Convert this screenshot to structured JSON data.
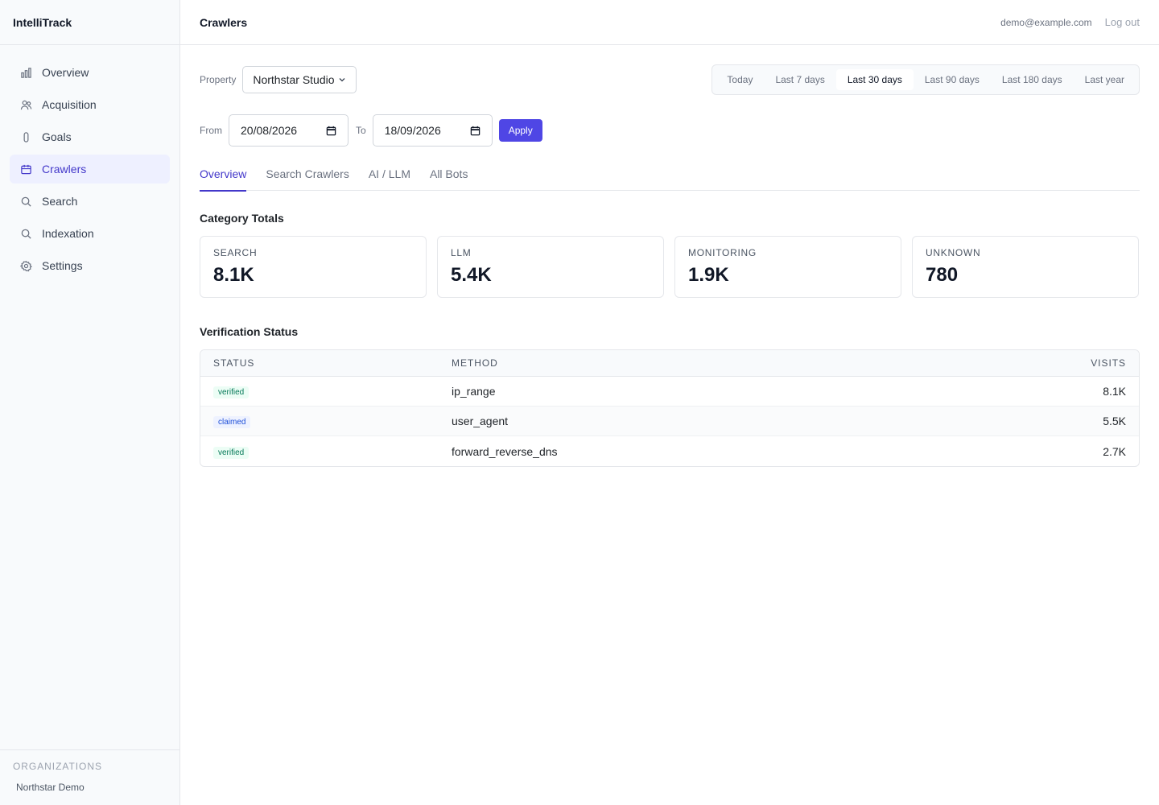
{
  "app": {
    "name": "IntelliTrack"
  },
  "sidebar": {
    "items": [
      {
        "label": "Overview",
        "icon": "bar-chart-icon",
        "active": false
      },
      {
        "label": "Acquisition",
        "icon": "users-icon",
        "active": false
      },
      {
        "label": "Goals",
        "icon": "target-icon",
        "active": false
      },
      {
        "label": "Crawlers",
        "icon": "calendar-icon",
        "active": true
      },
      {
        "label": "Search",
        "icon": "search-icon",
        "active": false
      },
      {
        "label": "Indexation",
        "icon": "search-icon",
        "active": false
      },
      {
        "label": "Settings",
        "icon": "gear-icon",
        "active": false
      }
    ],
    "orgs_title": "ORGANIZATIONS",
    "org_name": "Northstar Demo"
  },
  "header": {
    "title": "Crawlers",
    "user_email": "demo@example.com",
    "logout_label": "Log out"
  },
  "filters": {
    "property_label": "Property",
    "property_value": "Northstar Studio",
    "ranges": [
      "Today",
      "Last 7 days",
      "Last 30 days",
      "Last 90 days",
      "Last 180 days",
      "Last year"
    ],
    "active_range": "Last 30 days",
    "from_label": "From",
    "from_value": "20/08/2026",
    "to_label": "To",
    "to_value": "18/09/2026",
    "apply_label": "Apply"
  },
  "tabs": [
    "Overview",
    "Search Crawlers",
    "AI / LLM",
    "All Bots"
  ],
  "active_tab": "Overview",
  "category_totals": {
    "title": "Category Totals",
    "cards": [
      {
        "label": "SEARCH",
        "value": "8.1K"
      },
      {
        "label": "LLM",
        "value": "5.4K"
      },
      {
        "label": "MONITORING",
        "value": "1.9K"
      },
      {
        "label": "UNKNOWN",
        "value": "780"
      }
    ]
  },
  "verification": {
    "title": "Verification Status",
    "columns": [
      "STATUS",
      "METHOD",
      "VISITS"
    ],
    "rows": [
      {
        "status": "verified",
        "method": "ip_range",
        "visits": "8.1K"
      },
      {
        "status": "claimed",
        "method": "user_agent",
        "visits": "5.5K"
      },
      {
        "status": "verified",
        "method": "forward_reverse_dns",
        "visits": "2.7K"
      }
    ]
  },
  "colors": {
    "accent": "#4f46e5",
    "active_nav_bg": "#eef0ff",
    "verified": "#047857",
    "claimed": "#1d4ed8"
  }
}
